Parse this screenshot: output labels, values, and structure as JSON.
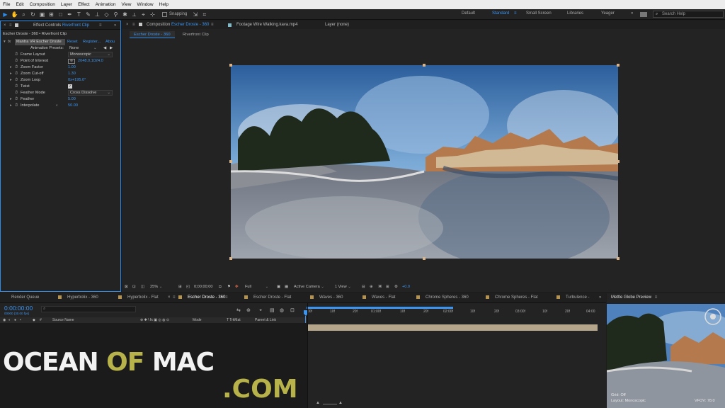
{
  "menu": [
    "File",
    "Edit",
    "Composition",
    "Layer",
    "Effect",
    "Animation",
    "View",
    "Window",
    "Help"
  ],
  "toolbar": {
    "snapping_label": "Snapping"
  },
  "workspaces": [
    "Default",
    "Standard",
    "Small Screen",
    "Libraries",
    "Yeager"
  ],
  "help_search_placeholder": "Search Help",
  "effect_controls": {
    "tab_label": "Effect Controls",
    "tab_clip": "Riverfront Clip",
    "layer_path": "Escher Droste - 360 • Riverfront Clip",
    "effect_name": "Mantra VR Escher Droste",
    "reset": "Reset",
    "register": "Register...",
    "about": "Abou",
    "animation_presets_label": "Animation Presets:",
    "animation_presets_value": "None",
    "properties": [
      {
        "name": "Frame Layout",
        "value": "Monoscopic",
        "kind": "dropdown"
      },
      {
        "name": "Point of Interest",
        "value": "2048.0,1024.0",
        "kind": "point"
      },
      {
        "name": "Zoom Factor",
        "value": "1.00",
        "kind": "value"
      },
      {
        "name": "Zoom Cut-off",
        "value": "1.30",
        "kind": "value"
      },
      {
        "name": "Zoom Loop",
        "value": "0x+195.0°",
        "kind": "value"
      },
      {
        "name": "Twist",
        "value": "",
        "kind": "checkbox"
      },
      {
        "name": "Feather Mode",
        "value": "Cross Dissolve",
        "kind": "dropdown"
      },
      {
        "name": "Feather",
        "value": "5.00",
        "kind": "value"
      },
      {
        "name": "Interpolate",
        "value": "50.00",
        "kind": "value"
      }
    ]
  },
  "composition": {
    "tab_label": "Composition",
    "tab_name": "Escher Droste - 360",
    "footage_tab": "Footage  Wire Walking.kava.mp4",
    "layer_tab": "Layer  (none)",
    "subtabs": [
      "Escher Droste - 360",
      "Riverfront Clip"
    ],
    "zoom": "25%",
    "timecode": "0;00;00;00",
    "resolution": "Full",
    "camera": "Active Camera",
    "views": "1 View",
    "exposure": "+0.0"
  },
  "timeline": {
    "tabs": [
      "Render Queue",
      "Hyperbolix - 360",
      "Hyperbolix - Flat",
      "Escher Droste - 360",
      "Escher Droste - Flat",
      "Waves - 360",
      "Waves - Flat",
      "Chrome Spheres - 360",
      "Chrome Spheres - Flat",
      "Turbulence -"
    ],
    "timecode": "0:00:00:00",
    "frame_info": "00000 (30.00 fps)",
    "columns": [
      "Source Name",
      "Mode",
      "T TrkMat",
      "Parent & Link"
    ],
    "ruler": [
      "00f",
      "10f",
      "20f",
      "01:00f",
      "10f",
      "20f",
      "02:00f",
      "10f",
      "20f",
      "03:00f",
      "10f",
      "20f",
      "04:00"
    ]
  },
  "preview": {
    "title": "Mettle Globe Preview",
    "grid": "Grid: Off",
    "layout": "Layout: Monoscopic",
    "vfov": "VFOV: 78.0"
  },
  "watermark": {
    "ocean": "OCEAN",
    "of": "OF",
    "mac": "MAC",
    "com": ".COM"
  },
  "colors": {
    "accent": "#2d8ceb",
    "panel": "#232323",
    "watermark_yellow": "#b8b24a"
  }
}
